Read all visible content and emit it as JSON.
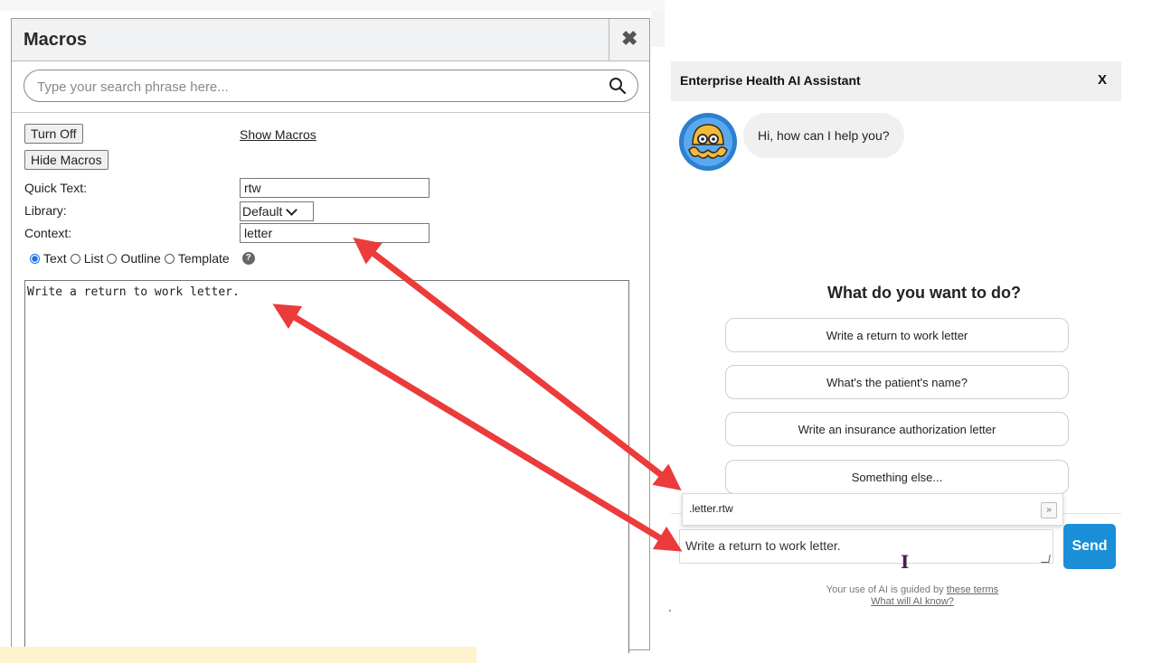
{
  "macros": {
    "title": "Macros",
    "close_glyph": "✖",
    "search_placeholder": "Type your search phrase here...",
    "turn_off_label": "Turn Off",
    "hide_macros_label": "Hide Macros",
    "show_macros_label": "Show Macros",
    "quick_text_label": "Quick Text:",
    "quick_text_value": "rtw",
    "library_label": "Library:",
    "library_value": "Default",
    "context_label": "Context:",
    "context_value": "letter",
    "radio_options": [
      "Text",
      "List",
      "Outline",
      "Template"
    ],
    "radio_selected": "Text",
    "macro_text": "Write a return to work letter."
  },
  "assistant": {
    "title": "Enterprise Health AI Assistant",
    "close_label": "X",
    "greeting": "Hi, how can I help you?",
    "prompt_title": "What do you want to do?",
    "choices": [
      "Write a return to work letter",
      "What's the patient's name?",
      "Write an insurance authorization letter",
      "Something else..."
    ],
    "autocomplete_text": ".letter.rtw",
    "autocomplete_expand": "»",
    "input_value": "Write a return to work letter.",
    "send_label": "Send",
    "terms_prefix": "Your use of AI is guided by ",
    "terms_link": "these terms",
    "know_link": "What will AI know?"
  },
  "colors": {
    "send_button": "#1a8fd8",
    "arrow": "#ec3b3b",
    "highlight_bar": "#fdf3cf"
  }
}
